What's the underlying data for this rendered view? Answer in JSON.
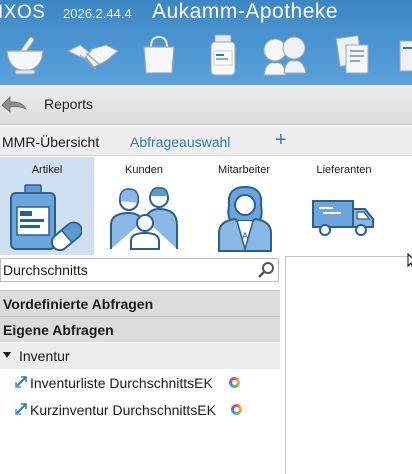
{
  "titlebar": {
    "app_name": "IXOS",
    "version": "2026.2.44.4",
    "pharmacy": "Aukamm-Apotheke"
  },
  "ribbon": {
    "icons": [
      "mortar-icon",
      "handshake-icon",
      "shopping-bag-icon",
      "medicine-bottle-icon",
      "customers-icon",
      "documents-icon",
      "more-icon"
    ]
  },
  "navigation": {
    "back_label": "Reports"
  },
  "tabs": {
    "active": "MMR-Übersicht",
    "link": "Abfrageauswahl",
    "add": "+"
  },
  "categories": [
    {
      "label": "Artikel",
      "icon": "medicine-package-icon",
      "active": true
    },
    {
      "label": "Kunden",
      "icon": "family-icon",
      "active": false
    },
    {
      "label": "Mitarbeiter",
      "icon": "employee-icon",
      "active": false
    },
    {
      "label": "Lieferanten",
      "icon": "delivery-truck-icon",
      "active": false
    }
  ],
  "search": {
    "value": "Durchschnitts",
    "icon": "search-icon"
  },
  "sections": {
    "predefined": "Vordefinierte Abfragen",
    "own": "Eigene Abfragen"
  },
  "group": {
    "label": "Inventur",
    "expanded": true
  },
  "queries": [
    {
      "label": "Inventurliste DurchschnittsEK",
      "icon": "link-arrows-icon",
      "badge": "color-wheel-icon"
    },
    {
      "label": "Kurzinventur DurchschnittsEK",
      "icon": "link-arrows-icon",
      "badge": "color-wheel-icon"
    }
  ],
  "colors": {
    "ribbon": "#4b96d2",
    "accent": "#2f7bc0",
    "active_tile": "#cfe0f2"
  }
}
